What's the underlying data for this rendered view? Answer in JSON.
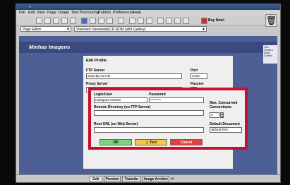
{
  "menu": [
    "File",
    "Edit",
    "View",
    "Page",
    "Image",
    "Text Processing",
    "Publish",
    "Preferences",
    "Help"
  ],
  "toolbar": {
    "page_select": "Page Editor",
    "format_select": "Standard: Revisteda(CD-ROM (with Gallery)",
    "buy_now": "Buy Now!"
  },
  "canvas": {
    "banner_title": "Minhas Imagens",
    "right_nav": [
      "Visit",
      "Fichas e",
      "Dicas",
      "Contato"
    ]
  },
  "form": {
    "heading": "Edit Profile",
    "ftp_server_label": "FTP Server",
    "ftp_server_value": "www.ftp.com.br",
    "port_label": "Port",
    "port_value": "2100",
    "proxy_server_label": "Proxy Server",
    "passive_label": "Passive",
    "login_label": "Login/User",
    "login_value": "rodrigues+www9",
    "password_label": "Password",
    "password_value": "********",
    "remote_dir_label": "Remote Directory (on FTP Server)",
    "remote_dir_value": "",
    "max_conn_label": "Max. Concurrent Connections:",
    "max_conn_value": "2",
    "root_url_label": "Root URL (on Web Server)",
    "root_url_value": "",
    "default_doc_label": "Default Document",
    "default_doc_value": "default.htm",
    "ok_label": "OK",
    "test_label": "Test",
    "cancel_label": "Cancel"
  },
  "tabs": [
    "Edit",
    "Preview",
    "Transfer",
    "Image Archive"
  ],
  "colors": {
    "highlight_border": "#c8102e",
    "canvas_bg": "#4d5f95",
    "ok_button": "#7fd27f",
    "test_button": "#f2c84b",
    "cancel_button": "#e04040"
  }
}
